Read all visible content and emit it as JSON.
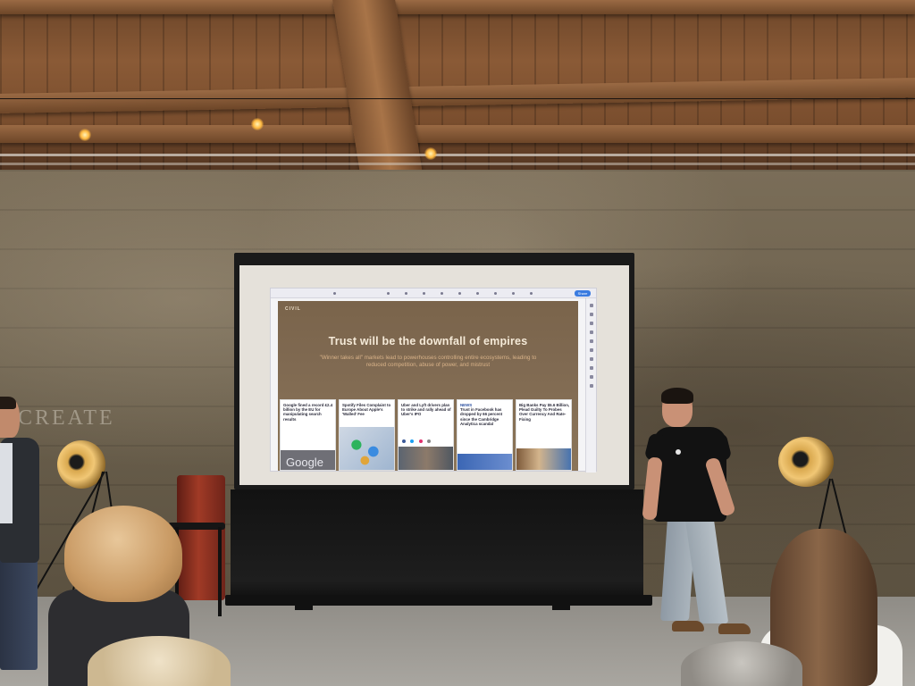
{
  "scene": {
    "wall_sign": "CREATE"
  },
  "projected_slide": {
    "logo": "CIVIL",
    "toolbar_share": "Share",
    "title": "Trust will be the downfall of empires",
    "subtitle": "\"Winner takes all\" markets lead to powerhouses controlling entire ecosystems, leading to reduced competition, abuse of power, and mistrust",
    "cards": [
      {
        "title": "Google fined a record £2.4 billion by the EU for manipulating search results",
        "meta": "",
        "bottom_text": "Google"
      },
      {
        "title": "Spotify Files Complaint to Europe About Apple's 'Walled' Fee",
        "meta": ""
      },
      {
        "title": "Uber and Lyft drivers plan to strike and rally ahead of Uber's IPO",
        "meta": ""
      },
      {
        "tag": "NEWS",
        "title": "Trust in Facebook has dropped by 66 percent since the Cambridge Analytica scandal",
        "meta": ""
      },
      {
        "title": "Big Banks Pay $5.6 Billion, Plead Guilty To Probes Over Currency And Rate-Fixing",
        "meta": ""
      }
    ]
  },
  "colors": {
    "slide_bg": "#7a644b",
    "slide_title": "#f5ead8",
    "slide_subtitle": "#d9b389",
    "lamp_gold": "#f1c775",
    "barrel_red": "#a03a26"
  }
}
